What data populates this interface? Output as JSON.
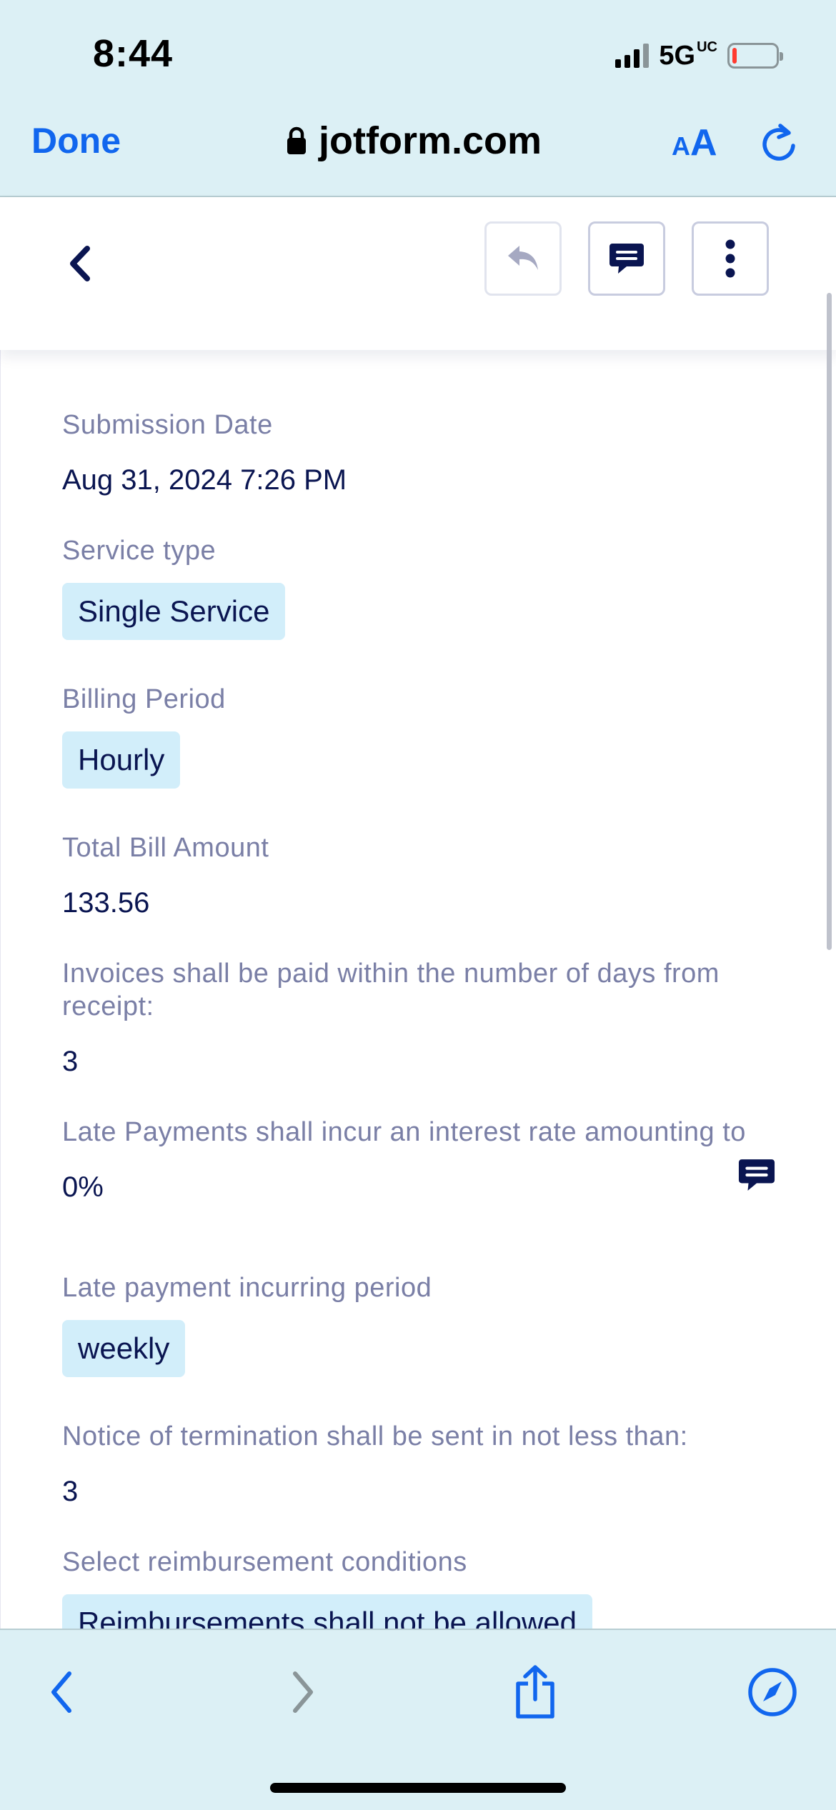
{
  "status_bar": {
    "time": "8:44",
    "network": "5G",
    "network_suffix": "UC",
    "battery_level": 0.1
  },
  "browser": {
    "done_label": "Done",
    "url": "jotform.com",
    "text_size_small": "A",
    "text_size_big": "A"
  },
  "submission": {
    "fields": [
      {
        "label": "Submission Date",
        "value": "Aug 31, 2024 7:26 PM"
      },
      {
        "label": "Service type",
        "value": "Single Service"
      },
      {
        "label": "Billing Period",
        "value": "Hourly"
      },
      {
        "label": "Total Bill Amount",
        "value": "133.56"
      },
      {
        "label": "Invoices shall be paid within the number of days from receipt:",
        "value": "3"
      },
      {
        "label": "Late Payments shall incur an interest rate amounting to",
        "value": "0%"
      },
      {
        "label": "Late payment incurring period",
        "value": "weekly"
      },
      {
        "label": "Notice of termination shall be sent in not less than:",
        "value": "3"
      },
      {
        "label": "Select reimbursement conditions",
        "value": "Reimbursements shall not be allowed"
      }
    ]
  },
  "colors": {
    "browser_chrome": "#dcf0f5",
    "browser_accent": "#1166ee",
    "text_primary": "#0a1551",
    "text_label": "#7a7fa6",
    "chip_background": "#d2eefa"
  }
}
